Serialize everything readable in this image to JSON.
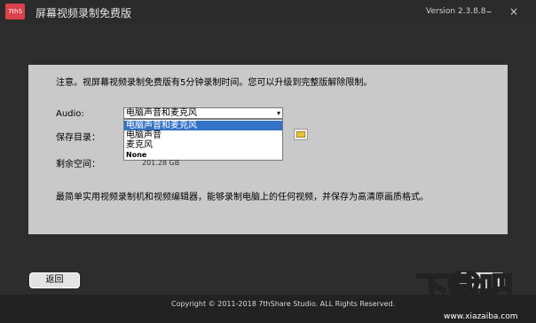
{
  "app": {
    "logo_text": "7thS",
    "title": "屏幕视频录制免费版",
    "version": "Version 2.3.8.8",
    "minimize": "–",
    "close": "×"
  },
  "notice": "注意。视屏幕视频录制免费版有5分钟录制时间。您可以升级到完整版解除限制。",
  "audio": {
    "label": "Audio:",
    "selected": "电脑声音和麦克风",
    "options": [
      "电脑声音和麦克风",
      "电脑声音",
      "麦克风",
      "None"
    ],
    "highlighted_option": "电脑声音和麦克风"
  },
  "save_dir": {
    "label": "保存目录："
  },
  "free_space": {
    "label": "剩余空间：",
    "value": "201.28 GB"
  },
  "description": "最简单实用视频录制机和视频编辑器，能够录制电脑上的任何视频，并保存为高清原画质格式。",
  "buttons": {
    "back": "返回"
  },
  "footer": {
    "copyright": "Copyright © 2011-2018 7thShare Studio. ALL Rights Reserved."
  },
  "watermark": {
    "text": "下载吧",
    "url": "www.xiazaiba.com"
  },
  "colors": {
    "accent": "#d9414b",
    "highlight": "#3372c6",
    "panel": "#c9c9c9",
    "background": "#2d2d2d"
  }
}
